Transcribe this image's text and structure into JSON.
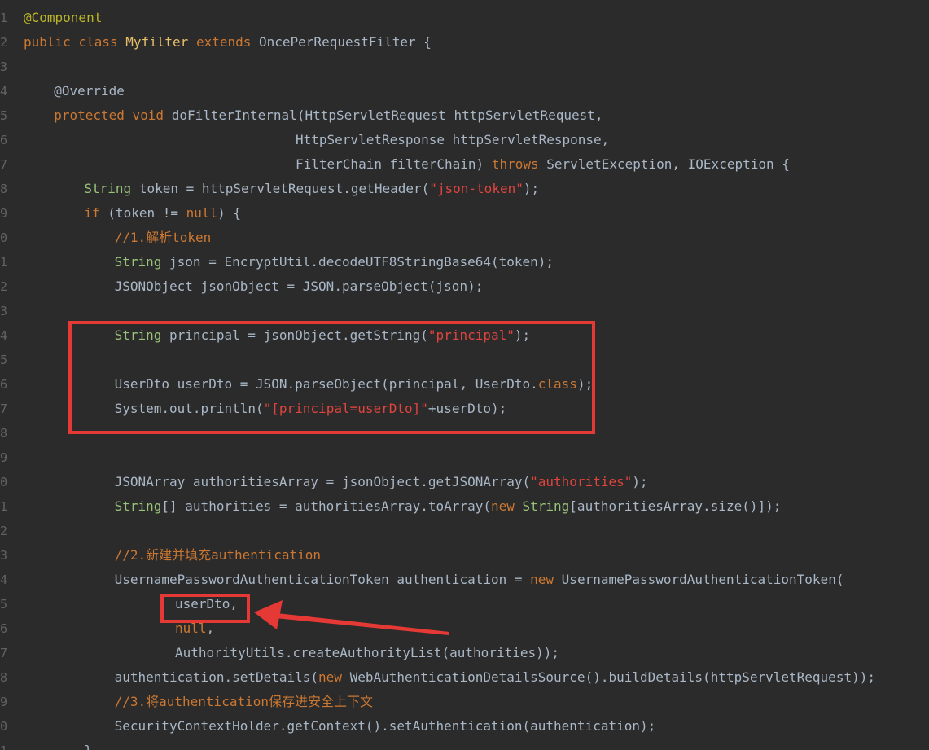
{
  "editor": {
    "start_line_number": 1,
    "lines": [
      {
        "num": "1",
        "indent": 0,
        "tokens": [
          {
            "t": "ann",
            "v": "@Component"
          }
        ]
      },
      {
        "num": "2",
        "indent": 0,
        "tokens": [
          {
            "t": "kw",
            "v": "public "
          },
          {
            "t": "kw",
            "v": "class "
          },
          {
            "t": "cls",
            "v": "Myfilter "
          },
          {
            "t": "kw",
            "v": "extends "
          },
          {
            "t": "plain",
            "v": "OncePerRequestFilter {"
          }
        ]
      },
      {
        "num": "3",
        "indent": 0,
        "tokens": []
      },
      {
        "num": "4",
        "indent": 1,
        "tokens": [
          {
            "t": "plain",
            "v": "@Override"
          }
        ]
      },
      {
        "num": "5",
        "indent": 1,
        "tokens": [
          {
            "t": "kw",
            "v": "protected "
          },
          {
            "t": "kw",
            "v": "void "
          },
          {
            "t": "plain",
            "v": "doFilterInternal(HttpServletRequest httpServletRequest,"
          }
        ]
      },
      {
        "num": "6",
        "indent": 9,
        "tokens": [
          {
            "t": "plain",
            "v": "HttpServletResponse httpServletResponse,"
          }
        ]
      },
      {
        "num": "7",
        "indent": 9,
        "tokens": [
          {
            "t": "plain",
            "v": "FilterChain filterChain) "
          },
          {
            "t": "kw",
            "v": "throws "
          },
          {
            "t": "plain",
            "v": "ServletException, IOException {"
          }
        ]
      },
      {
        "num": "8",
        "indent": 2,
        "tokens": [
          {
            "t": "type",
            "v": "String "
          },
          {
            "t": "plain",
            "v": "token = httpServletRequest.getHeader("
          },
          {
            "t": "str",
            "v": "\"json-token\""
          },
          {
            "t": "plain",
            "v": ");"
          }
        ]
      },
      {
        "num": "9",
        "indent": 2,
        "tokens": [
          {
            "t": "kw",
            "v": "if "
          },
          {
            "t": "plain",
            "v": "(token != "
          },
          {
            "t": "kw",
            "v": "null"
          },
          {
            "t": "plain",
            "v": ") {"
          }
        ]
      },
      {
        "num": "0",
        "indent": 3,
        "tokens": [
          {
            "t": "cmt",
            "v": "//1.解析token"
          }
        ]
      },
      {
        "num": "1",
        "indent": 3,
        "tokens": [
          {
            "t": "type",
            "v": "String "
          },
          {
            "t": "plain",
            "v": "json = EncryptUtil.decodeUTF8StringBase64(token);"
          }
        ]
      },
      {
        "num": "2",
        "indent": 3,
        "tokens": [
          {
            "t": "plain",
            "v": "JSONObject jsonObject = JSON.parseObject(json);"
          }
        ]
      },
      {
        "num": "3",
        "indent": 0,
        "tokens": []
      },
      {
        "num": "4",
        "indent": 3,
        "tokens": [
          {
            "t": "type",
            "v": "String "
          },
          {
            "t": "plain",
            "v": "principal = jsonObject.getString("
          },
          {
            "t": "str",
            "v": "\"principal\""
          },
          {
            "t": "plain",
            "v": ");"
          }
        ]
      },
      {
        "num": "5",
        "indent": 0,
        "tokens": []
      },
      {
        "num": "6",
        "indent": 3,
        "tokens": [
          {
            "t": "plain",
            "v": "UserDto userDto = JSON.parseObject(principal, UserDto."
          },
          {
            "t": "kw",
            "v": "class"
          },
          {
            "t": "plain",
            "v": ");"
          }
        ]
      },
      {
        "num": "7",
        "indent": 3,
        "tokens": [
          {
            "t": "plain",
            "v": "System.out.println("
          },
          {
            "t": "str",
            "v": "\"[principal=userDto]\""
          },
          {
            "t": "plain",
            "v": "+userDto);"
          }
        ]
      },
      {
        "num": "8",
        "indent": 0,
        "tokens": []
      },
      {
        "num": "9",
        "indent": 0,
        "tokens": []
      },
      {
        "num": "0",
        "indent": 3,
        "tokens": [
          {
            "t": "plain",
            "v": "JSONArray authoritiesArray = jsonObject.getJSONArray("
          },
          {
            "t": "str",
            "v": "\"authorities\""
          },
          {
            "t": "plain",
            "v": ");"
          }
        ]
      },
      {
        "num": "1",
        "indent": 3,
        "tokens": [
          {
            "t": "type",
            "v": "String"
          },
          {
            "t": "plain",
            "v": "[] authorities = authoritiesArray.toArray("
          },
          {
            "t": "kw",
            "v": "new "
          },
          {
            "t": "type",
            "v": "String"
          },
          {
            "t": "plain",
            "v": "[authoritiesArray.size()]);"
          }
        ]
      },
      {
        "num": "2",
        "indent": 0,
        "tokens": []
      },
      {
        "num": "3",
        "indent": 3,
        "tokens": [
          {
            "t": "cmt",
            "v": "//2.新建并填充authentication"
          }
        ]
      },
      {
        "num": "4",
        "indent": 3,
        "tokens": [
          {
            "t": "plain",
            "v": "UsernamePasswordAuthenticationToken authentication = "
          },
          {
            "t": "kw",
            "v": "new "
          },
          {
            "t": "plain",
            "v": "UsernamePasswordAuthenticationToken("
          }
        ]
      },
      {
        "num": "5",
        "indent": 5,
        "tokens": [
          {
            "t": "plain",
            "v": "userDto,"
          }
        ]
      },
      {
        "num": "6",
        "indent": 5,
        "tokens": [
          {
            "t": "kw",
            "v": "null"
          },
          {
            "t": "plain",
            "v": ","
          }
        ]
      },
      {
        "num": "7",
        "indent": 5,
        "tokens": [
          {
            "t": "plain",
            "v": "AuthorityUtils.createAuthorityList(authorities));"
          }
        ]
      },
      {
        "num": "8",
        "indent": 3,
        "tokens": [
          {
            "t": "plain",
            "v": "authentication.setDetails("
          },
          {
            "t": "kw",
            "v": "new "
          },
          {
            "t": "plain",
            "v": "WebAuthenticationDetailsSource().buildDetails(httpServletRequest));"
          }
        ]
      },
      {
        "num": "9",
        "indent": 3,
        "tokens": [
          {
            "t": "cmt",
            "v": "//3.将authentication保存进安全上下文"
          }
        ]
      },
      {
        "num": "0",
        "indent": 3,
        "tokens": [
          {
            "t": "plain",
            "v": "SecurityContextHolder.getContext().setAuthentication(authentication);"
          }
        ]
      },
      {
        "num": "1",
        "indent": 2,
        "tokens": [
          {
            "t": "plain",
            "v": "}"
          }
        ]
      }
    ]
  },
  "annotations": {
    "highlight_color": "#e53935"
  }
}
